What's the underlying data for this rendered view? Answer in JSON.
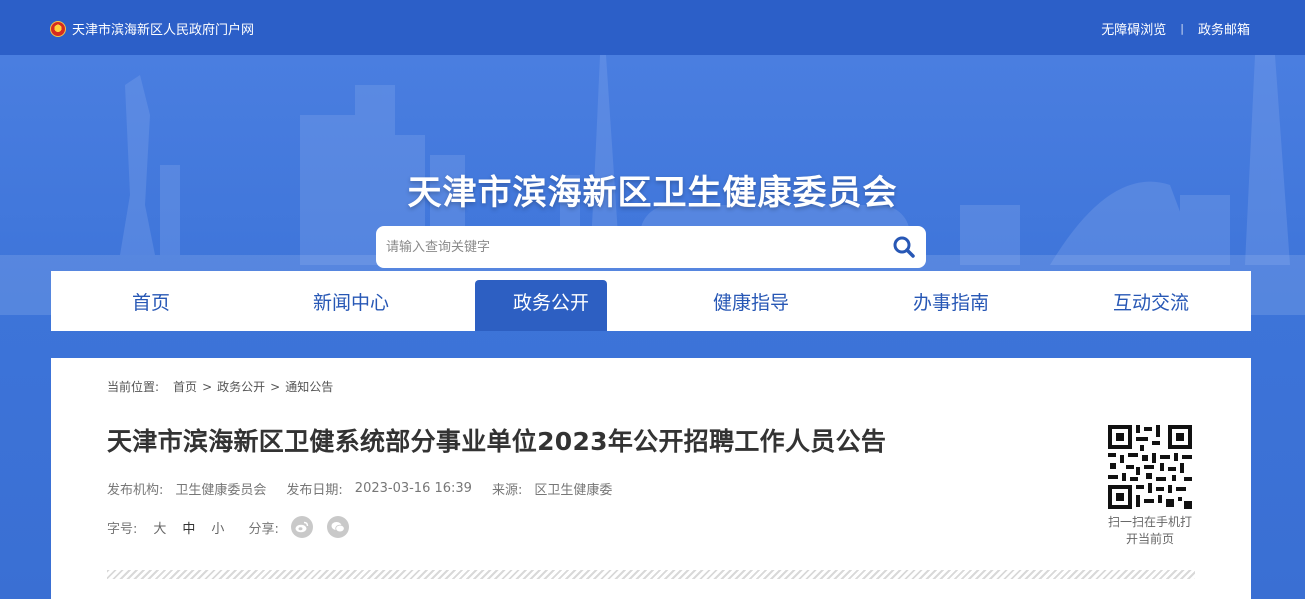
{
  "topbar": {
    "portal_name": "天津市滨海新区人民政府门户网",
    "accessibility_link": "无障碍浏览",
    "separator": "|",
    "mailbox_link": "政务邮箱"
  },
  "header": {
    "site_title": "天津市滨海新区卫生健康委员会"
  },
  "search": {
    "placeholder": "请输入查询关键字",
    "value": ""
  },
  "nav": {
    "items": [
      {
        "label": "首页"
      },
      {
        "label": "新闻中心"
      },
      {
        "label": "政务公开"
      },
      {
        "label": "健康指导"
      },
      {
        "label": "办事指南"
      },
      {
        "label": "互动交流"
      }
    ],
    "active_index": 2
  },
  "breadcrumb": {
    "label": "当前位置:",
    "items": [
      "首页",
      "政务公开",
      "通知公告"
    ],
    "separator": ">"
  },
  "article": {
    "title": "天津市滨海新区卫健系统部分事业单位2023年公开招聘工作人员公告",
    "publisher_label": "发布机构:",
    "publisher": "卫生健康委员会",
    "date_label": "发布日期:",
    "date": "2023-03-16 16:39",
    "source_label": "来源:",
    "source": "区卫生健康委"
  },
  "tools": {
    "font_size_label": "字号:",
    "font_sizes": [
      "大",
      "中",
      "小"
    ],
    "current_font_size": "中",
    "share_label": "分享:",
    "share_icons": [
      "weibo-icon",
      "wechat-icon"
    ]
  },
  "qr": {
    "caption_line1": "扫一扫在手机打",
    "caption_line2": "开当前页"
  },
  "colors": {
    "primary": "#2d5fc2",
    "nav_text": "#2757b5",
    "hero_bg": "#3d74d9"
  }
}
